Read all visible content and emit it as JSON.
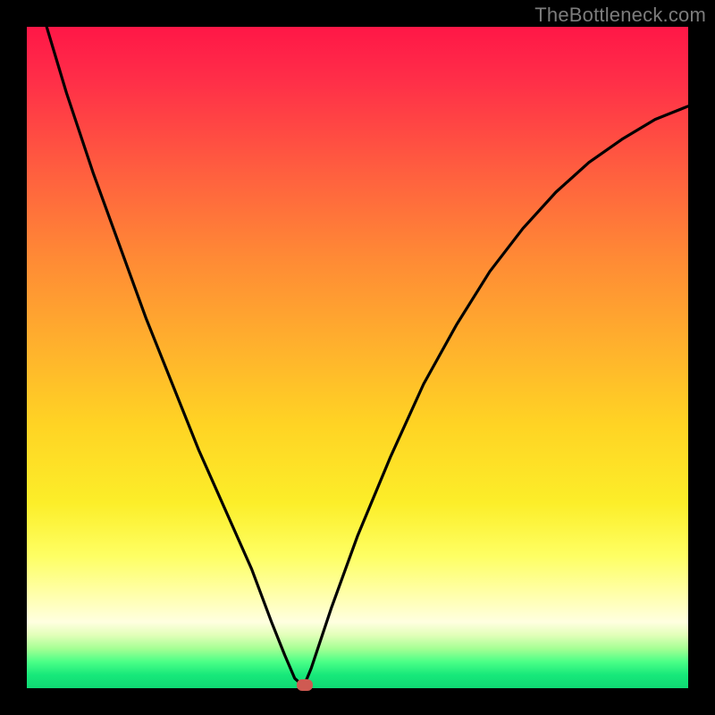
{
  "watermark": "TheBottleneck.com",
  "chart_data": {
    "type": "line",
    "title": "",
    "xlabel": "",
    "ylabel": "",
    "xlim": [
      0,
      100
    ],
    "ylim": [
      0,
      100
    ],
    "grid": false,
    "series": [
      {
        "name": "curve",
        "x": [
          3,
          6,
          10,
          14,
          18,
          22,
          26,
          30,
          34,
          37,
          39,
          40.5,
          41.5,
          42,
          43,
          46,
          50,
          55,
          60,
          65,
          70,
          75,
          80,
          85,
          90,
          95,
          100
        ],
        "y": [
          100,
          90,
          78,
          67,
          56,
          46,
          36,
          27,
          18,
          10,
          5,
          1.5,
          0.6,
          0.6,
          3,
          12,
          23,
          35,
          46,
          55,
          63,
          69.5,
          75,
          79.5,
          83,
          86,
          88
        ]
      }
    ],
    "marker": {
      "x": 42,
      "y": 0.6,
      "color": "#cf5a52"
    },
    "colors": {
      "gradient_top": "#ff1747",
      "gradient_mid": "#ffd324",
      "gradient_bottom": "#0fd973",
      "curve": "#000000",
      "frame": "#000000"
    }
  }
}
